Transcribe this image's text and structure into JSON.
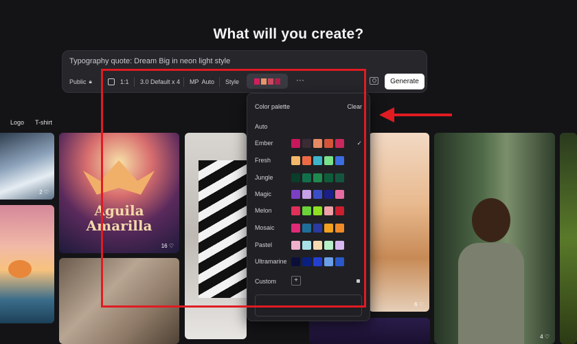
{
  "header": {
    "title": "What will you create?"
  },
  "prompt": {
    "text": "Typography quote: Dream Big in neon light style"
  },
  "toolbar": {
    "visibility": "Public",
    "ratio": "1:1",
    "model": "3.0 Default x 4",
    "mp_label": "MP",
    "mp_value": "Auto",
    "style_label": "Style",
    "style_colors": [
      "#d41f5c",
      "#e8976a",
      "#c94a5f",
      "#b01f4a"
    ],
    "more": "···",
    "generate": "Generate"
  },
  "categories": [
    "Logo",
    "T-shirt"
  ],
  "gallery": [
    {
      "text": "Aguila Amarilla",
      "likes": "16"
    },
    {
      "likes": "2"
    },
    {
      "likes": "6"
    },
    {
      "likes": "4"
    }
  ],
  "palette_menu": {
    "heading": "Color palette",
    "clear": "Clear",
    "auto": "Auto",
    "selected": "Ember",
    "palettes": [
      {
        "name": "Ember",
        "colors": [
          "#c8175a",
          "#3a2b35",
          "#e68a63",
          "#d4543a",
          "#c9285c"
        ]
      },
      {
        "name": "Fresh",
        "colors": [
          "#f2b96b",
          "#ec6a43",
          "#3fb4c9",
          "#7ae28a",
          "#3b6ee0"
        ]
      },
      {
        "name": "Jungle",
        "colors": [
          "#0a3d2a",
          "#11704a",
          "#1f8a4e",
          "#0e5d3a",
          "#155540"
        ]
      },
      {
        "name": "Magic",
        "colors": [
          "#7b3fc4",
          "#c6a2e8",
          "#3a4ec8",
          "#1a1f8a",
          "#e86aa2"
        ]
      },
      {
        "name": "Melon",
        "colors": [
          "#e0305a",
          "#6ad33a",
          "#8fe022",
          "#f0a0a8",
          "#cc1e2e"
        ]
      },
      {
        "name": "Mosaic",
        "colors": [
          "#e02a78",
          "#1f6e9a",
          "#2a3aa0",
          "#f2a21e",
          "#f08a28"
        ]
      },
      {
        "name": "Pastel",
        "colors": [
          "#f0b0cc",
          "#a8e0e8",
          "#f5d9b0",
          "#b8f0c8",
          "#d8b8f0"
        ]
      },
      {
        "name": "Ultramarine",
        "colors": [
          "#0a0f3a",
          "#0a2080",
          "#2440d0",
          "#6aa0e8",
          "#2a58c8"
        ]
      }
    ],
    "custom": "Custom",
    "check": "✓",
    "plus": "+"
  }
}
